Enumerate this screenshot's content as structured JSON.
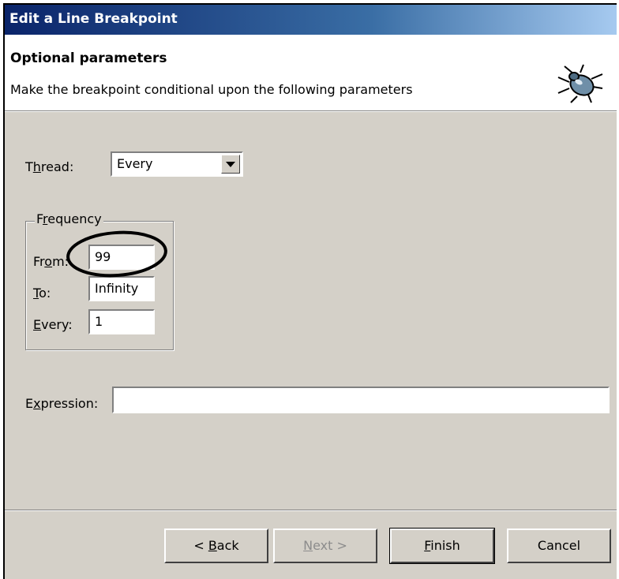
{
  "window": {
    "title": "Edit a Line Breakpoint"
  },
  "header": {
    "title": "Optional parameters",
    "description": "Make the breakpoint conditional upon the following parameters",
    "icon": "bug-icon"
  },
  "thread": {
    "label_pre": "T",
    "label_accel": "h",
    "label_post": "read:",
    "value": "Every"
  },
  "frequency": {
    "legend_pre": "F",
    "legend_accel": "r",
    "legend_post": "equency",
    "from": {
      "label_pre": "Fr",
      "label_accel": "o",
      "label_post": "m:",
      "value": "99"
    },
    "to": {
      "label_pre": "",
      "label_accel": "T",
      "label_post": "o:",
      "value": "Infinity"
    },
    "every": {
      "label_pre": "",
      "label_accel": "E",
      "label_post": "very:",
      "value": "1"
    }
  },
  "expression": {
    "label_pre": "E",
    "label_accel": "x",
    "label_post": "pression:",
    "value": ""
  },
  "buttons": {
    "back": {
      "pre": "< ",
      "accel": "B",
      "post": "ack"
    },
    "next": {
      "pre": "",
      "accel": "N",
      "post": "ext >"
    },
    "finish": {
      "pre": "",
      "accel": "F",
      "post": "inish"
    },
    "cancel": {
      "label": "Cancel"
    }
  },
  "annotation": {
    "shape": "ellipse-marker",
    "color": "#000000"
  }
}
